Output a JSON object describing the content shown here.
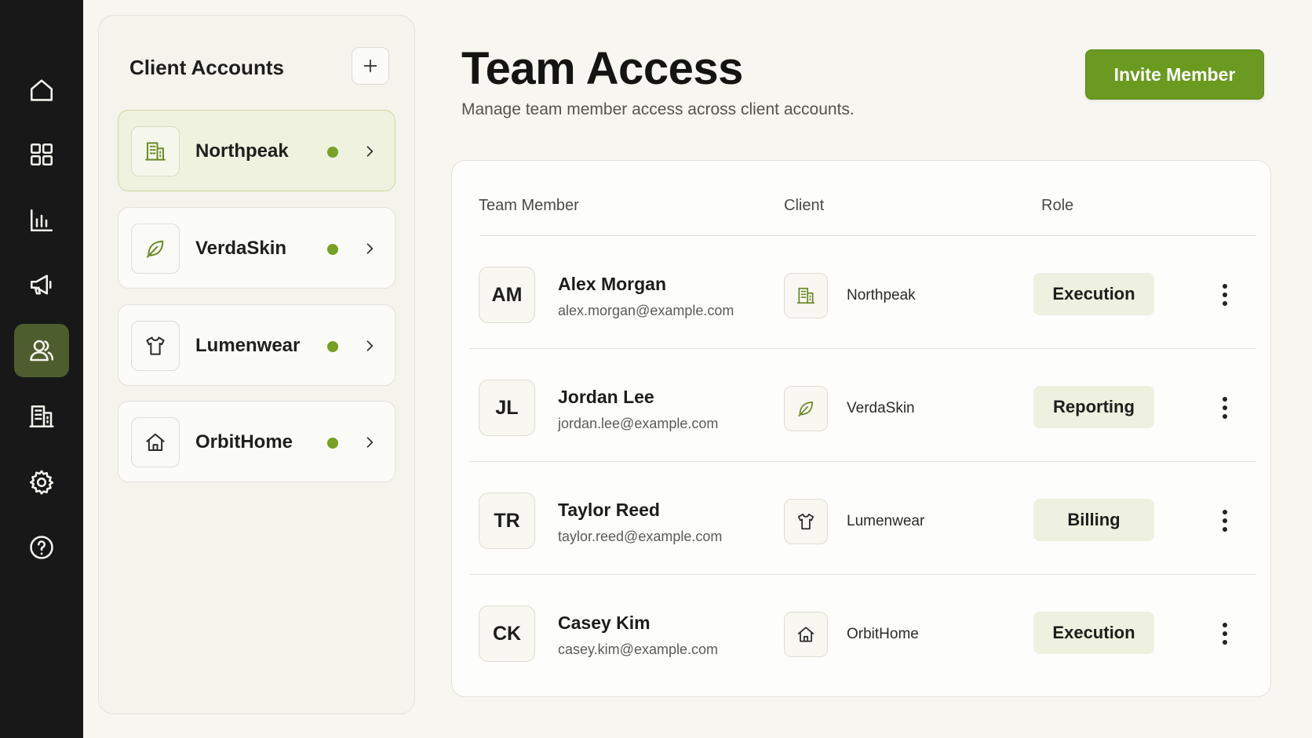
{
  "colors": {
    "rail_bg": "#181818",
    "rail_active": "#4e5d2d",
    "accent_green": "#6a9a1f",
    "status_dot": "#76a125",
    "active_card_bg": "#eef2df",
    "role_badge_bg": "#eef0e0",
    "page_bg": "#f7f6f1"
  },
  "rail": {
    "items": [
      {
        "icon": "home-icon",
        "active": false
      },
      {
        "icon": "dashboard-grid-icon",
        "active": false
      },
      {
        "icon": "bar-chart-icon",
        "active": false
      },
      {
        "icon": "megaphone-icon",
        "active": false
      },
      {
        "icon": "users-icon",
        "active": true
      },
      {
        "icon": "building-icon",
        "active": false
      },
      {
        "icon": "settings-gear-icon",
        "active": false
      },
      {
        "icon": "help-circle-icon",
        "active": false
      }
    ]
  },
  "clients_panel": {
    "title": "Client Accounts",
    "add_icon": "plus-icon",
    "items": [
      {
        "name": "Northpeak",
        "icon": "building-icon",
        "status": "active",
        "selected": true
      },
      {
        "name": "VerdaSkin",
        "icon": "leaf-icon",
        "status": "active",
        "selected": false
      },
      {
        "name": "Lumenwear",
        "icon": "shirt-icon",
        "status": "active",
        "selected": false
      },
      {
        "name": "OrbitHome",
        "icon": "house-icon",
        "status": "active",
        "selected": false
      }
    ]
  },
  "header": {
    "title": "Team Access",
    "subtitle": "Manage team member access across client accounts.",
    "invite_label": "Invite Member"
  },
  "table": {
    "columns": [
      "Team Member",
      "Client",
      "Role"
    ],
    "rows": [
      {
        "initials": "AM",
        "name": "Alex Morgan",
        "email": "alex.morgan@example.com",
        "client": "Northpeak",
        "client_icon": "building-icon",
        "role": "Execution"
      },
      {
        "initials": "JL",
        "name": "Jordan Lee",
        "email": "jordan.lee@example.com",
        "client": "VerdaSkin",
        "client_icon": "leaf-icon",
        "role": "Reporting"
      },
      {
        "initials": "TR",
        "name": "Taylor Reed",
        "email": "taylor.reed@example.com",
        "client": "Lumenwear",
        "client_icon": "shirt-icon",
        "role": "Billing"
      },
      {
        "initials": "CK",
        "name": "Casey Kim",
        "email": "casey.kim@example.com",
        "client": "OrbitHome",
        "client_icon": "house-icon",
        "role": "Execution"
      }
    ]
  }
}
